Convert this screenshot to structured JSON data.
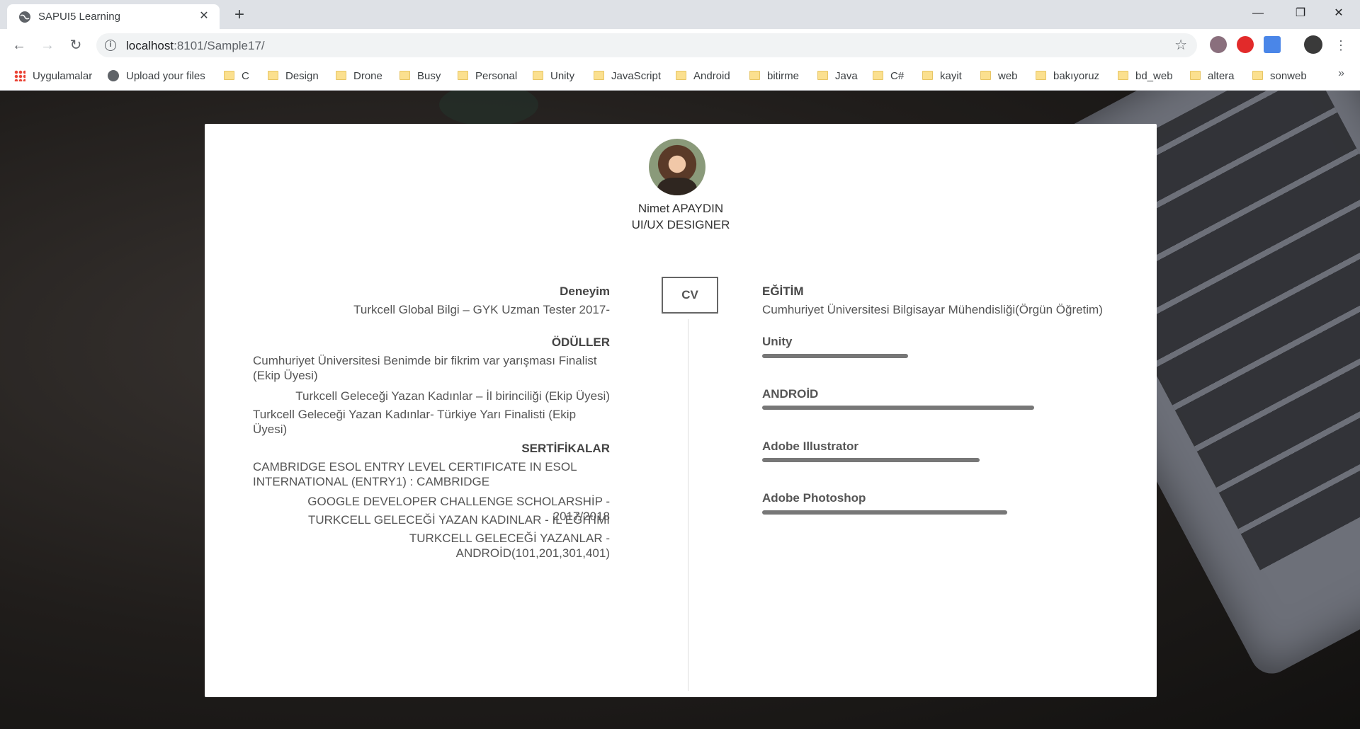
{
  "browser": {
    "tab_title": "SAPUI5 Learning",
    "url_host": "localhost",
    "url_rest": ":8101/Sample17/",
    "bookmarks": [
      "Uygulamalar",
      "Upload your files",
      "C",
      "Design",
      "Drone",
      "Busy",
      "Personal",
      "Unity",
      "JavaScript",
      "Android",
      "bitirme",
      "Java",
      "C#",
      "kayit",
      "web",
      "bakıyoruz",
      "bd_web",
      "altera",
      "sonweb"
    ],
    "more": "»"
  },
  "profile": {
    "name": "Nimet APAYDIN",
    "title": "UI/UX DESIGNER",
    "cv_label": "CV"
  },
  "left": {
    "experience_heading": "Deneyim",
    "experience_items": [
      "Turkcell Global Bilgi – GYK Uzman Tester 2017-"
    ],
    "awards_heading": "ÖDÜLLER",
    "award_items": [
      "Cumhuriyet Üniversitesi Benimde bir fikrim var yarışması Finalist (Ekip Üyesi)",
      "Turkcell Geleceği Yazan Kadınlar – İl birinciliği (Ekip Üyesi)",
      "Turkcell Geleceği Yazan Kadınlar- Türkiye Yarı Finalisti (Ekip Üyesi)"
    ],
    "certificates_heading": "SERTİFİKALAR",
    "certificate_items": [
      "CAMBRIDGE ESOL ENTRY LEVEL CERTIFICATE IN ESOL INTERNATIONAL (ENTRY1) : CAMBRIDGE",
      "GOOGLE DEVELOPER CHALLENGE SCHOLARSHİP - 2017/2018",
      "TURKCELL GELECEĞİ YAZAN KADINLAR - İL EĞİTİMİ",
      "TURKCELL GELECEĞİ YAZANLAR - ANDROİD(101,201,301,401)"
    ]
  },
  "right": {
    "education_heading": "EĞİTİM",
    "education_text": "Cumhuriyet Üniversitesi Bilgisayar Mühendisliği(Örgün Öğretim)",
    "skills": [
      {
        "name": "Unity",
        "level": 0.43
      },
      {
        "name": "ANDROİD",
        "level": 0.8
      },
      {
        "name": "Adobe Illustrator",
        "level": 0.64
      },
      {
        "name": "Adobe Photoshop",
        "level": 0.72
      }
    ]
  }
}
